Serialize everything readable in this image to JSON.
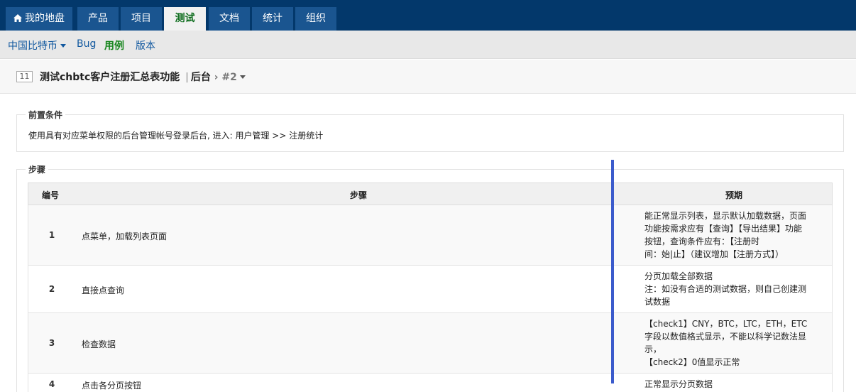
{
  "nav": {
    "tabs": [
      "我的地盘",
      "产品",
      "项目",
      "测试",
      "文档",
      "统计",
      "组织"
    ],
    "active": "测试"
  },
  "subnav": {
    "product": "中国比特币",
    "bug": "Bug",
    "cases": "用例",
    "build": "版本",
    "active": "用例"
  },
  "case": {
    "id": "11",
    "title": "测试chbtc客户注册汇总表功能",
    "module": "后台",
    "separator": "|",
    "version": "#2"
  },
  "precondition": {
    "legend": "前置条件",
    "text": "使用具有对应菜单权限的后台管理帐号登录后台, 进入: 用户管理 >> 注册统计"
  },
  "steps": {
    "legend": "步骤",
    "headers": {
      "num": "编号",
      "step": "步骤",
      "expect": "预期"
    },
    "rows": [
      {
        "num": "1",
        "step": "点菜单，加载列表页面",
        "expect": [
          "能正常显示列表，显示默认加载数据，页面",
          "功能按需求应有【查询】【导出结果】功能",
          "按钮，查询条件应有：【注册时",
          "间：始|止】（建议增加【注册方式】）"
        ]
      },
      {
        "num": "2",
        "step": "直接点查询",
        "expect": [
          "分页加载全部数据",
          "注：如没有合适的测试数据，则自己创建测",
          "试数据"
        ]
      },
      {
        "num": "3",
        "step": "检查数据",
        "expect": [
          "【check1】CNY，BTC，LTC，ETH，ETC",
          "字段以数值格式显示，不能以科学记数法显",
          "示，",
          "【check2】0值显示正常"
        ]
      },
      {
        "num": "4",
        "step": "点击各分页按钮",
        "expect": [
          "正常显示分页数据"
        ]
      }
    ]
  },
  "colors": {
    "topnav": "#03386b",
    "tab": "#1a5590",
    "active_tab_text": "#0b6b1b",
    "link": "#11589f",
    "active_link": "#17861e",
    "overlay_line": "#3b5bcc"
  }
}
